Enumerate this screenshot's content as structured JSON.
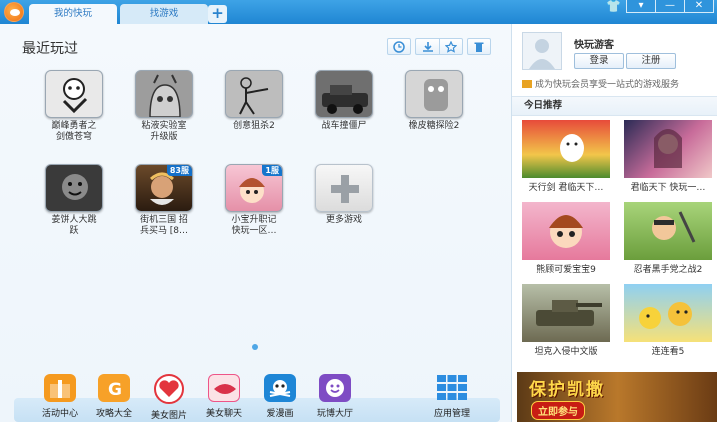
{
  "tabs": {
    "active": "我的快玩",
    "inactive": "找游戏",
    "add": "+"
  },
  "window": {
    "skin": "👕",
    "menu": "▾",
    "min": "—",
    "close": "✕"
  },
  "recent": {
    "title": "最近玩过",
    "games": [
      {
        "name": "巅峰勇者之剑傲苍穹",
        "label": "巅峰勇者之\n剑傲苍穹",
        "badge": ""
      },
      {
        "name": "粘液实验室升级版",
        "label": "粘液实验室\n升级版",
        "badge": ""
      },
      {
        "name": "创意狙杀2",
        "label": "创意狙杀2",
        "badge": ""
      },
      {
        "name": "战车撞僵尸",
        "label": "战车撞僵尸",
        "badge": ""
      },
      {
        "name": "橡皮糖探险2",
        "label": "橡皮糖探险2",
        "badge": ""
      },
      {
        "name": "姜饼人大跳跃",
        "label": "姜饼人大跳\n跃",
        "badge": ""
      },
      {
        "name": "街机三国 招兵买马",
        "label": "街机三国 招\n兵买马 [8…",
        "badge": "83服"
      },
      {
        "name": "小宝升职记 快玩一区",
        "label": "小宝升职记\n快玩一区…",
        "badge": "1服"
      },
      {
        "name": "更多游戏",
        "label": "更多游戏",
        "badge": ""
      }
    ]
  },
  "dock": [
    {
      "label": "活动中心",
      "color": "#f59a1f"
    },
    {
      "label": "攻略大全",
      "color": "#f7a128"
    },
    {
      "label": "美女图片",
      "color": "#e3353d"
    },
    {
      "label": "美女聊天",
      "color": "#d9324a"
    },
    {
      "label": "爱漫画",
      "color": "#1e86d6"
    },
    {
      "label": "玩博大厅",
      "color": "#7e4cc4"
    },
    {
      "label": "应用管理",
      "color": "#2c8de0"
    }
  ],
  "user": {
    "name": "快玩游客",
    "login": "登录",
    "register": "注册",
    "vip_text": "成为快玩会员享受一站式的游戏服务"
  },
  "recommend": {
    "title": "今日推荐",
    "items": [
      {
        "caption": "天行剑  君临天下…"
      },
      {
        "caption": "君临天下  快玩一…"
      },
      {
        "caption": "熊顾可爱宝宝9"
      },
      {
        "caption": "忍者黑手党之战2"
      },
      {
        "caption": "坦克入侵中文版"
      },
      {
        "caption": "连连看5"
      }
    ]
  },
  "banner": {
    "title": "保护凯撒",
    "button": "立即参与"
  }
}
